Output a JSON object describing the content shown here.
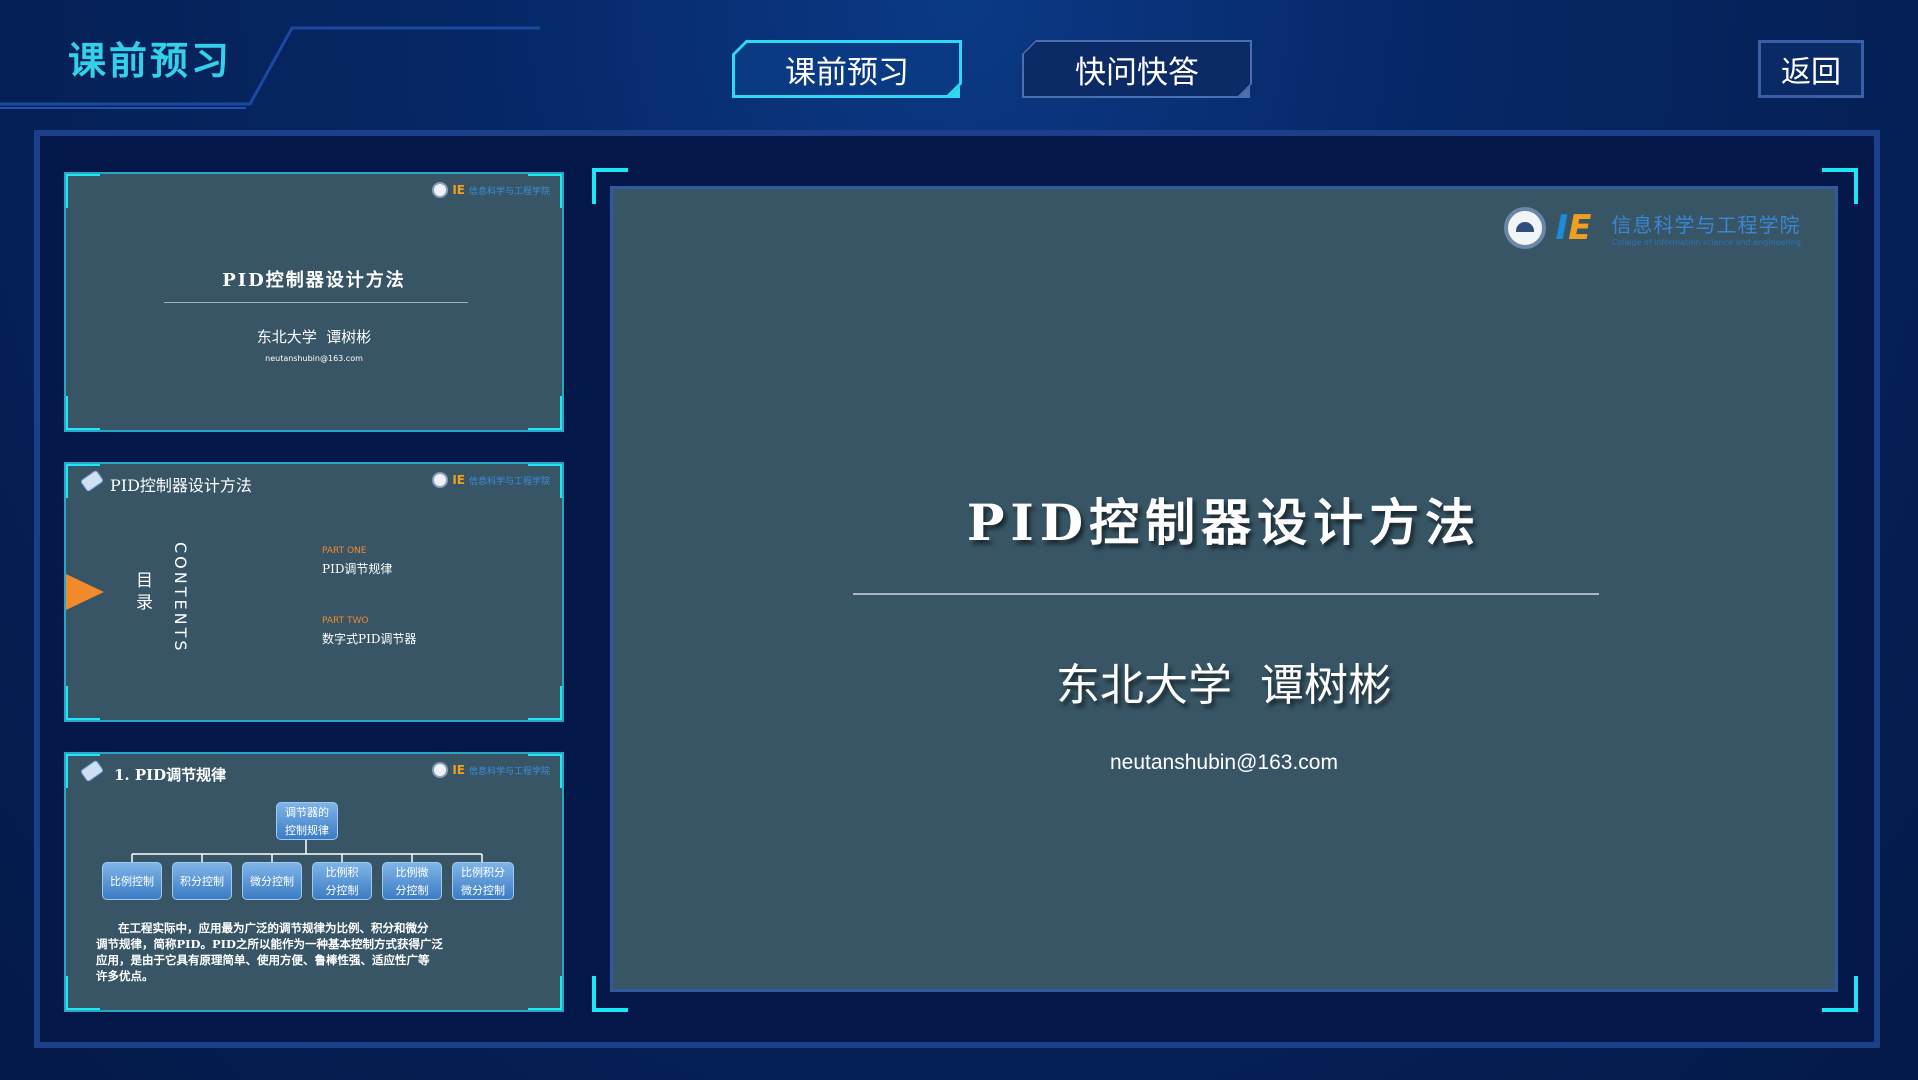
{
  "header": {
    "title": "课前预习",
    "tabs": [
      {
        "label": "课前预习",
        "active": true
      },
      {
        "label": "快问快答",
        "active": false
      }
    ],
    "back_label": "返回"
  },
  "thumbnails": {
    "slide1": {
      "title": "PID控制器设计方法",
      "author": "东北大学  谭树彬",
      "email": "neutanshubin@163.com",
      "school": "信息科学与工程学院"
    },
    "slide2": {
      "header": "PID控制器设计方法",
      "contents_cn": "目录",
      "contents_en": "CONTENTS",
      "part_one_label": "PART  ONE",
      "part_one_title": "PID调节规律",
      "part_two_label": "PART  TWO",
      "part_two_title": "数字式PID调节器",
      "school": "信息科学与工程学院"
    },
    "slide3": {
      "header": "1. PID调节规律",
      "root": [
        "调节器的",
        "控制规律"
      ],
      "nodes": [
        [
          "比例控制"
        ],
        [
          "积分控制"
        ],
        [
          "微分控制"
        ],
        [
          "比例积",
          "分控制"
        ],
        [
          "比例微",
          "分控制"
        ],
        [
          "比例积分",
          "微分控制"
        ]
      ],
      "paragraph": [
        "在工程实际中，应用最为广泛的调节规律为比例、积分和微分",
        "调节规律，简称PID。PID之所以能作为一种基本控制方式获得广泛",
        "应用，是由于它具有原理简单、使用方便、鲁棒性强、适应性广等",
        "许多优点。"
      ],
      "school": "信息科学与工程学院"
    }
  },
  "main_slide": {
    "title": "PID控制器设计方法",
    "author": "东北大学  谭树彬",
    "email": "neutanshubin@163.com",
    "school_cn": "信息科学与工程学院",
    "school_en": "College of information science and engineering"
  },
  "colors": {
    "accent": "#1ee6f6",
    "slide_bg": "#375565",
    "orange": "#f08a2a"
  }
}
